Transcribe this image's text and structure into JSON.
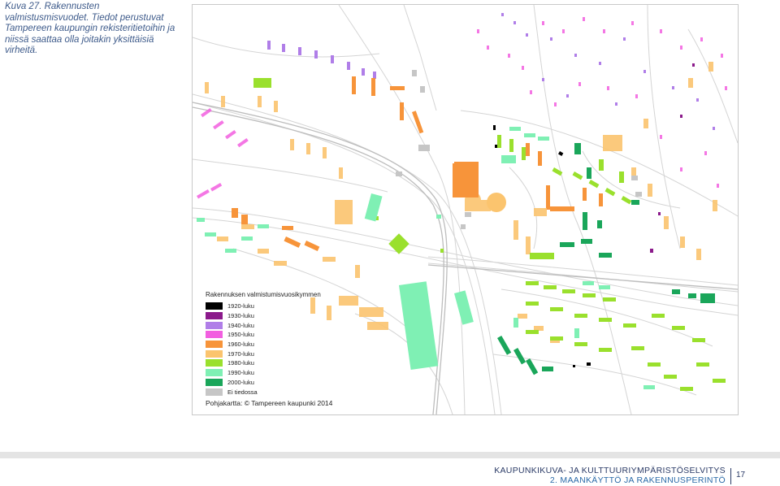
{
  "caption": "Kuva 27. Rakennusten valmistusmisvuodet. Tiedot perustuvat Tampereen kaupungin rekisteritietoihin ja niissä saattaa olla joitakin yksittäisiä virheitä.",
  "legend": {
    "title": "Rakennuksen valmistumisvuosikymmen",
    "items": [
      {
        "label": "1920-luku",
        "color": "#000000"
      },
      {
        "label": "1930-luku",
        "color": "#8b1a8b"
      },
      {
        "label": "1940-luku",
        "color": "#b07ee8"
      },
      {
        "label": "1950-luku",
        "color": "#f25fe0"
      },
      {
        "label": "1960-luku",
        "color": "#f7943a"
      },
      {
        "label": "1970-luku",
        "color": "#fbc46e"
      },
      {
        "label": "1980-luku",
        "color": "#9ae02d"
      },
      {
        "label": "1990-luku",
        "color": "#7ff0b4"
      },
      {
        "label": "2000-luku",
        "color": "#1aa65a"
      },
      {
        "label": "Ei tiedossa",
        "color": "#c6c6c6"
      }
    ]
  },
  "source": "Pohjakartta: © Tampereen kaupunki 2014",
  "footer": {
    "line1": "KAUPUNKIKUVA- JA KULTTUURIYMPÄRISTÖSELVITYS",
    "line2": "2. MAANKÄYTTÖ JA RAKENNUSPERINTÖ",
    "page": "17"
  }
}
